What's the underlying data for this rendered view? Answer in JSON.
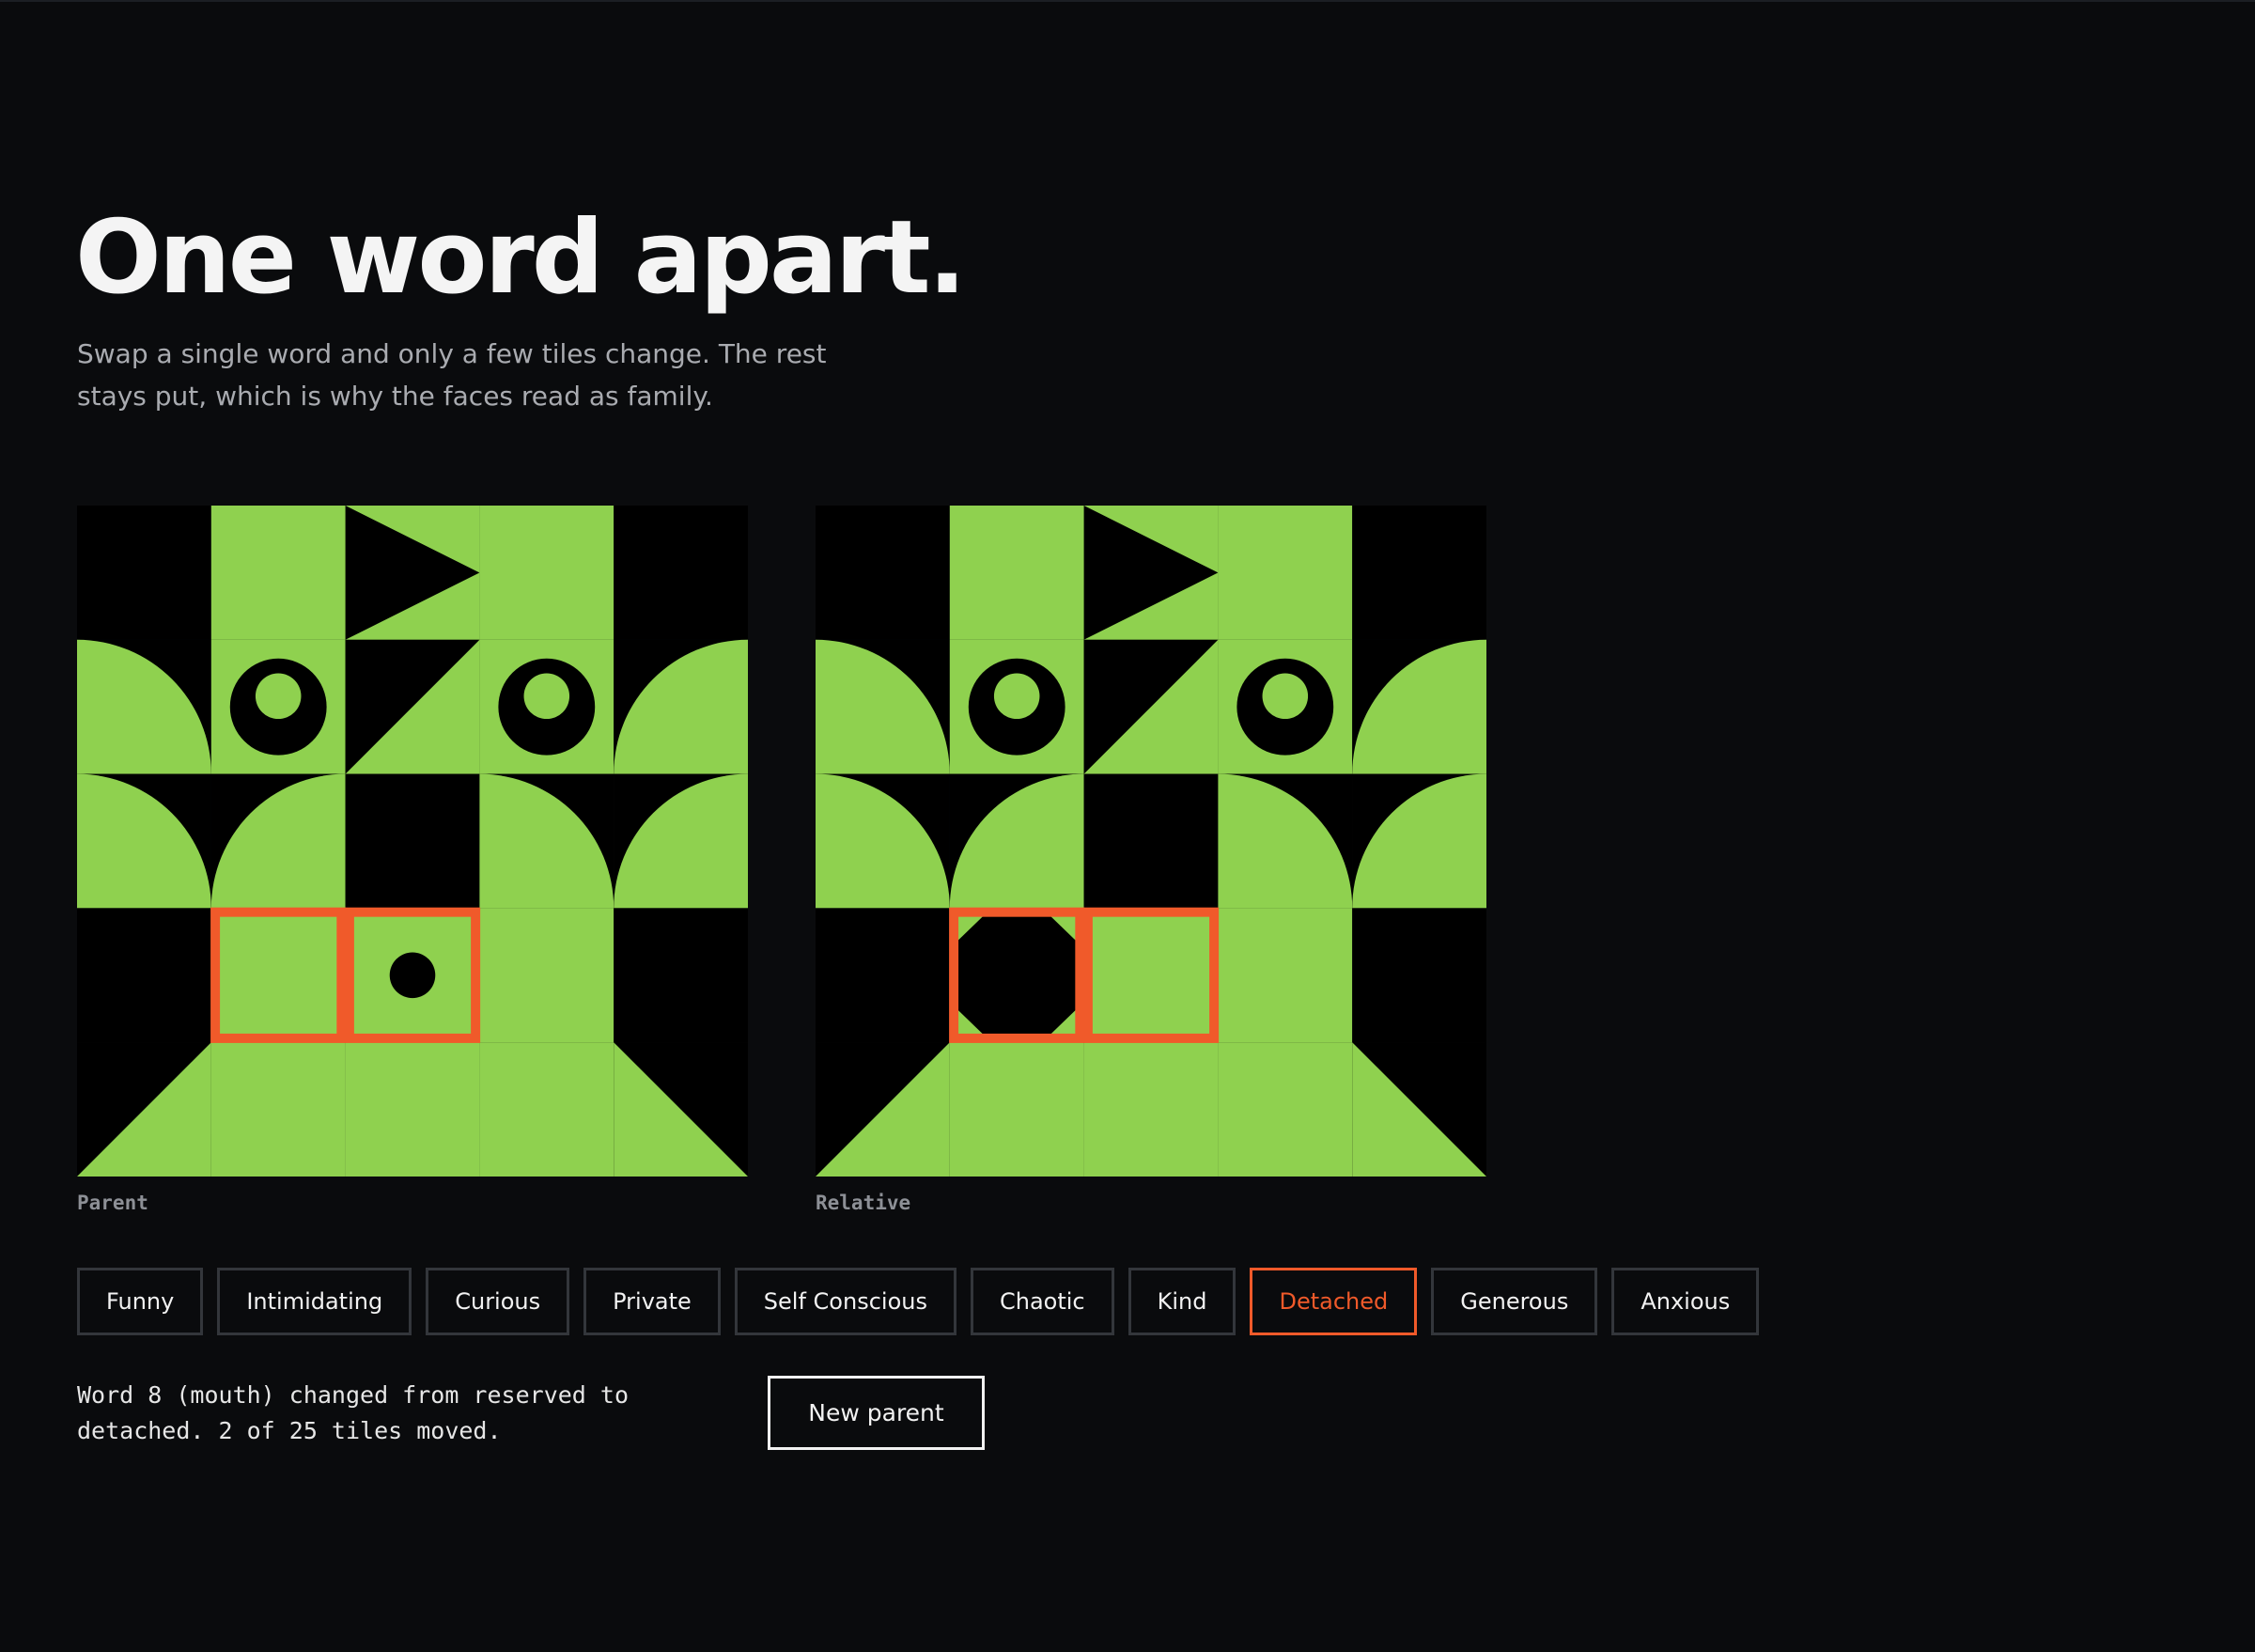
{
  "hero": {
    "title": "One word apart.",
    "subtitle": "Swap a single word and only a few tiles change. The rest stays put, which is why the faces read as family."
  },
  "faces": {
    "left_caption": "Parent",
    "right_caption": "Relative"
  },
  "colors": {
    "background": "#0a0b0d",
    "tile_green": "#8fd14f",
    "tile_black": "#000000",
    "highlight": "#f05a2a"
  },
  "words": [
    {
      "label": "Funny",
      "selected": false
    },
    {
      "label": "Intimidating",
      "selected": false
    },
    {
      "label": "Curious",
      "selected": false
    },
    {
      "label": "Private",
      "selected": false
    },
    {
      "label": "Self Conscious",
      "selected": false
    },
    {
      "label": "Chaotic",
      "selected": false
    },
    {
      "label": "Kind",
      "selected": false
    },
    {
      "label": "Detached",
      "selected": true
    },
    {
      "label": "Generous",
      "selected": false
    },
    {
      "label": "Anxious",
      "selected": false
    }
  ],
  "status": {
    "message": "Word 8 (mouth) changed from reserved to detached. 2 of 25 tiles moved.",
    "changed_tiles": 2,
    "total_tiles": 25
  },
  "actions": {
    "new_parent_label": "New parent"
  }
}
